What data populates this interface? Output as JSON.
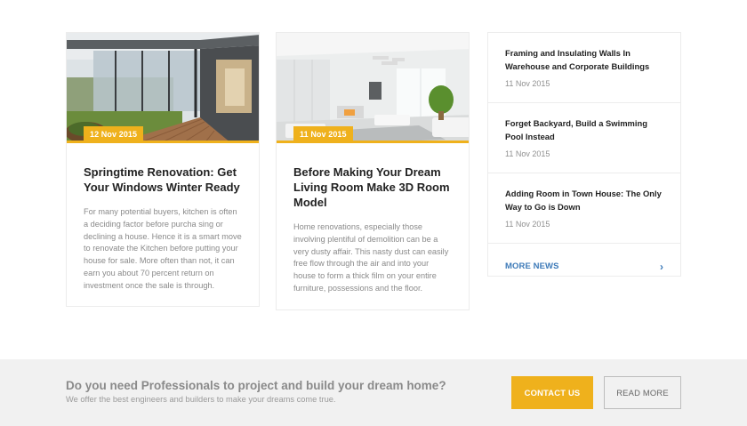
{
  "posts": [
    {
      "date": "12 Nov 2015",
      "title": "Springtime Renovation: Get Your Windows Winter Ready",
      "excerpt": "For many potential buyers, kitchen is often a deciding factor before purcha sing or declining a house. Hence it is a smart move to renovate the Kitchen before putting your house for sale. More often than not, it can earn you about 70 percent return on investment once the sale is through."
    },
    {
      "date": "11 Nov 2015",
      "title": "Before Making Your Dream Living Room Make 3D Room Model",
      "excerpt": "Home renovations, especially those involving plentiful of demolition can be a very dusty affair. This nasty dust can easily free flow through the air and into your house to form a thick film on your entire furniture, possessions and the floor."
    }
  ],
  "news": {
    "items": [
      {
        "title": "Framing and Insulating Walls In Warehouse and Corporate Buildings",
        "date": "11 Nov 2015"
      },
      {
        "title": "Forget Backyard, Build a Swimming Pool Instead",
        "date": "11 Nov 2015"
      },
      {
        "title": "Adding Room in Town House: The Only Way to Go is Down",
        "date": "11 Nov 2015"
      }
    ],
    "more_label": "MORE NEWS",
    "more_icon": "chevron-right-icon"
  },
  "cta": {
    "title": "Do you need Professionals to project and build your dream home?",
    "subtitle": "We offer the best engineers and builders to make your dreams come true.",
    "contact_label": "CONTACT US",
    "read_more_label": "READ MORE"
  },
  "colors": {
    "accent": "#efb11c",
    "link": "#3d7ab8",
    "cta_background": "#f1f1f1"
  }
}
